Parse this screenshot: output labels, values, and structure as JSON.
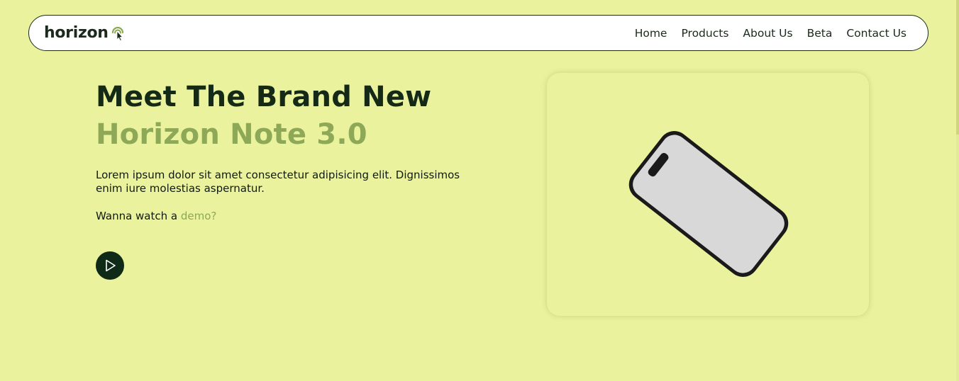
{
  "brand": {
    "name": "horizon",
    "icon": "cursor-click-icon"
  },
  "nav": {
    "items": [
      {
        "label": "Home"
      },
      {
        "label": "Products"
      },
      {
        "label": "About Us"
      },
      {
        "label": "Beta"
      },
      {
        "label": "Contact Us"
      }
    ]
  },
  "hero": {
    "title_line1": "Meet The Brand New",
    "title_line2": "Horizon Note 3.0",
    "description": "Lorem ipsum dolor sit amet consectetur adipisicing elit. Dignissimos enim iure molestias aspernatur.",
    "demo_prefix": "Wanna watch a ",
    "demo_link": "demo?",
    "play_icon": "play-icon"
  },
  "product": {
    "image": "smartphone-image"
  },
  "colors": {
    "background": "#ebf29d",
    "accent": "#8da857",
    "dark": "#0f2a16"
  }
}
